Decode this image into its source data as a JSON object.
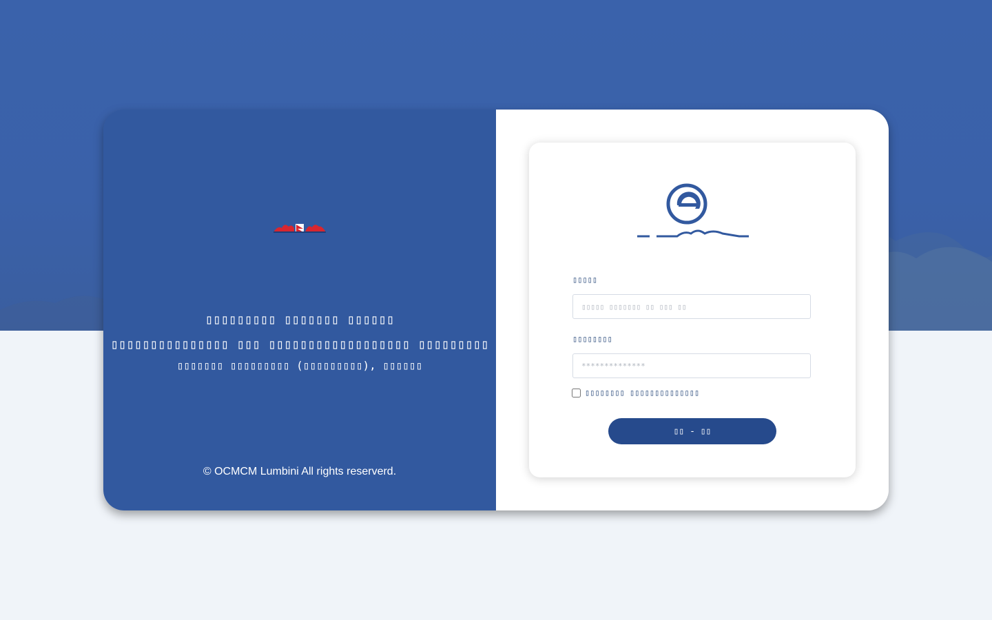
{
  "left_panel": {
    "org_line1": "▯▯▯▯▯▯▯▯▯ ▯▯▯▯▯▯▯ ▯▯▯▯▯▯",
    "org_line2": "▯▯▯▯▯▯▯▯▯▯▯▯▯▯▯ ▯▯▯ ▯▯▯▯▯▯▯▯▯▯▯▯▯▯▯▯▯▯ ▯▯▯▯▯▯▯▯▯",
    "org_line3": "▯▯▯▯▯▯▯ ▯▯▯▯▯▯▯▯▯ (▯▯▯▯▯▯▯▯▯), ▯▯▯▯▯▯",
    "copyright": "© OCMCM Lumbini All rights reserverd."
  },
  "login": {
    "username_label": "▯▯▯▯▯",
    "username_placeholder": "▯▯▯▯▯ ▯▯▯▯▯▯▯ ▯▯ ▯▯▯ ▯▯",
    "password_label": "▯▯▯▯▯▯▯▯",
    "password_placeholder": "**************",
    "remember_label": "▯▯▯▯▯▯▯▯ ▯▯▯▯▯▯▯▯▯▯▯▯▯▯",
    "submit_label": "▯▯ - ▯▯"
  },
  "colors": {
    "brand_blue": "#32599f",
    "button_blue": "#264a8c",
    "label_text": "#2f4f7f"
  }
}
